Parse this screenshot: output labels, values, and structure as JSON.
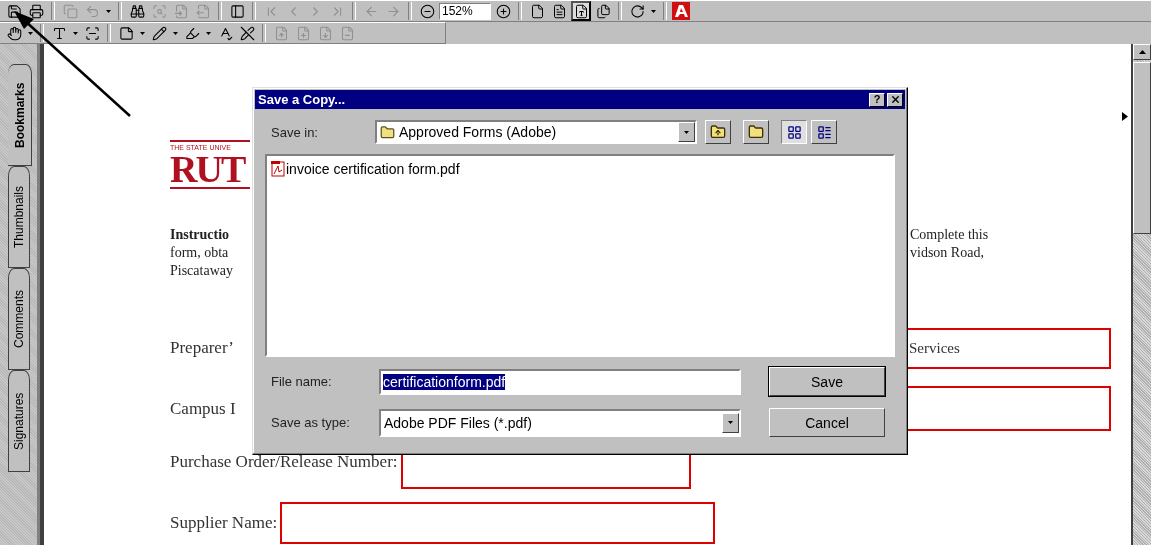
{
  "toolbar": {
    "zoom": "152%",
    "view_buttons": [
      {
        "selected": false
      },
      {
        "selected": false
      },
      {
        "selected": true
      },
      {
        "selected": false
      }
    ]
  },
  "side_tabs": [
    {
      "label": "Bookmarks",
      "selected": true
    },
    {
      "label": "Thumbnails",
      "selected": false
    },
    {
      "label": "Comments",
      "selected": false
    },
    {
      "label": "Signatures",
      "selected": false
    }
  ],
  "document": {
    "logo_tagline": "THE STATE UNIVE",
    "logo_wordmark": "RUT",
    "instructions": [
      {
        "left": "Instructio",
        "right": "Complete this",
        "bold": true
      },
      {
        "left": "form, obta",
        "right": "vidson Road,",
        "bold": false
      },
      {
        "left": "Piscataway",
        "bold": false
      }
    ],
    "fields": [
      {
        "label": "Preparer’",
        "value": "Services",
        "kind": "side"
      },
      {
        "label": "Campus I",
        "kind": "side"
      },
      {
        "label": "Purchase Order/Release Number:",
        "kind": "inline"
      },
      {
        "label": "Supplier Name:",
        "kind": "inline"
      }
    ]
  },
  "dialog": {
    "title": "Save a Copy...",
    "help": "?",
    "save_in_label": "Save in:",
    "save_in_value": "Approved Forms (Adobe)",
    "view_buttons": [
      {
        "selected": true
      },
      {
        "selected": false
      }
    ],
    "files": [
      {
        "name": "invoice certification form.pdf"
      }
    ],
    "file_name_label": "File name:",
    "file_name_value": "certificationform.pdf",
    "file_type_label": "Save as type:",
    "file_type_value": "Adobe PDF Files (*.pdf)",
    "buttons": [
      {
        "label": "Save",
        "default": true
      },
      {
        "label": "Cancel",
        "default": false
      }
    ]
  }
}
